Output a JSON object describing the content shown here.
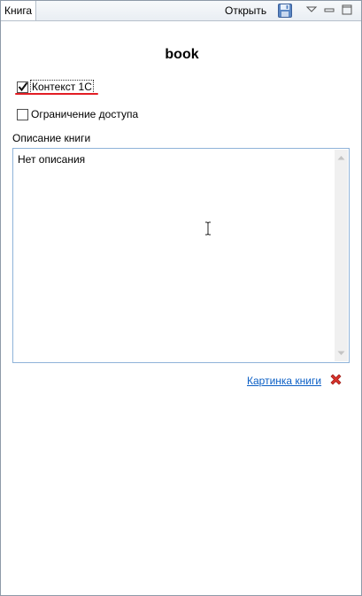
{
  "tab": {
    "label": "Книга",
    "open_label": "Открыть"
  },
  "icons": {
    "save": "save-icon",
    "view_menu": "chevron-down-icon",
    "minimize": "minimize-icon",
    "maximize": "maximize-icon",
    "delete": "delete-icon"
  },
  "form": {
    "title": "book",
    "context_checkbox": {
      "label": "Контекст 1С",
      "checked": true
    },
    "access_checkbox": {
      "label": "Ограничение доступа",
      "checked": false
    },
    "description": {
      "label": "Описание книги",
      "value": "Нет описания"
    },
    "picture_link": "Картинка книги"
  },
  "colors": {
    "link": "#0b5fc5",
    "delete": "#d9322b",
    "annotation": "#e21d24"
  }
}
